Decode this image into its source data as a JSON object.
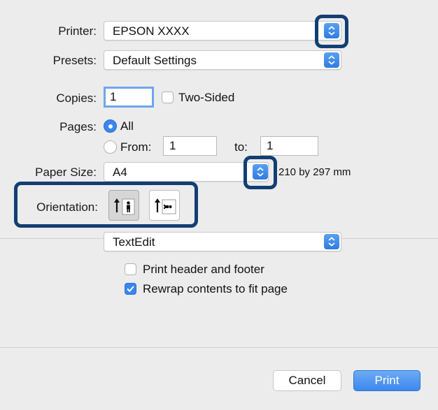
{
  "printer": {
    "label": "Printer:",
    "value": "EPSON XXXX"
  },
  "presets": {
    "label": "Presets:",
    "value": "Default Settings"
  },
  "copies": {
    "label": "Copies:",
    "value": "1",
    "two_sided_label": "Two-Sided",
    "two_sided_checked": false
  },
  "pages": {
    "label": "Pages:",
    "all_label": "All",
    "all_selected": true,
    "from_label": "From:",
    "from_value": "1",
    "to_label": "to:",
    "to_value": "1"
  },
  "paper_size": {
    "label": "Paper Size:",
    "value": "A4",
    "dimensions": "210 by 297 mm"
  },
  "orientation": {
    "label": "Orientation:",
    "options": [
      "portrait-icon",
      "landscape-icon"
    ],
    "selected": "portrait"
  },
  "section_popup": {
    "value": "TextEdit"
  },
  "options": [
    {
      "label": "Print header and footer",
      "checked": false
    },
    {
      "label": "Rewrap contents to fit page",
      "checked": true
    }
  ],
  "buttons": {
    "cancel": "Cancel",
    "print": "Print"
  },
  "colors": {
    "accent": "#3a86ee",
    "highlight": "#123f73",
    "background": "#ececec"
  }
}
